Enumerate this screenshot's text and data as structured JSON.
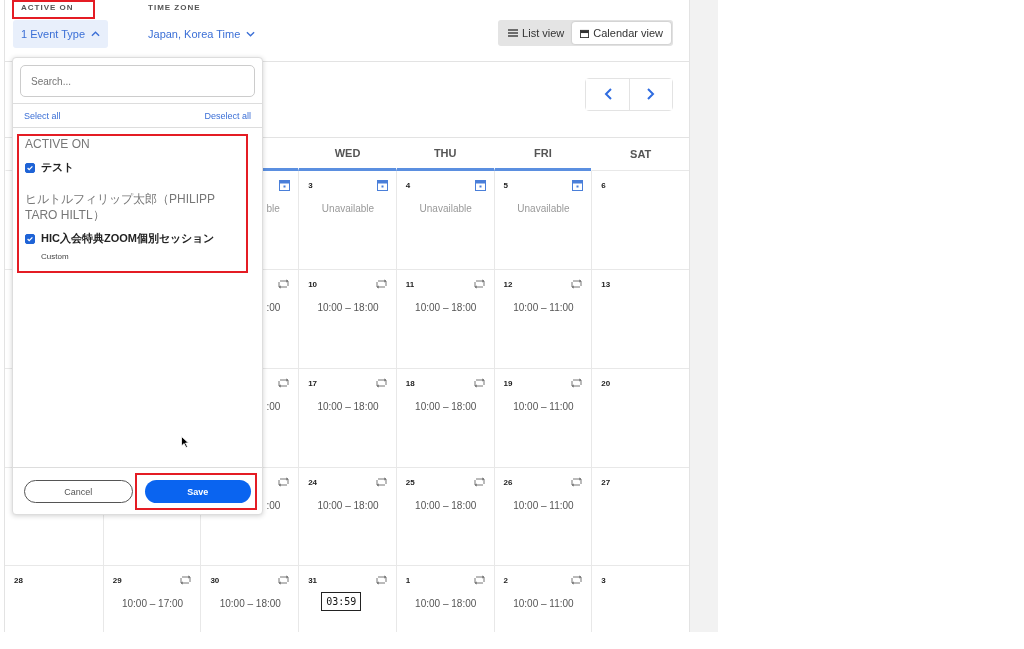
{
  "filters": [
    {
      "label": "ACTIVE ON",
      "value": "1 Event Type",
      "expanded": true
    },
    {
      "label": "TIME ZONE",
      "value": "Japan, Korea Time",
      "expanded": false
    }
  ],
  "view_toggle": [
    {
      "label": "List view",
      "selected": false
    },
    {
      "label": "Calendar view",
      "selected": true
    }
  ],
  "dropdown": {
    "search_placeholder": "Search...",
    "select_all": "Select all",
    "deselect_all": "Deselect all",
    "groups": [
      {
        "title": "ACTIVE ON",
        "items": [
          {
            "label": "テスト",
            "checked": true
          }
        ]
      },
      {
        "title": "ヒルトルフィリップ太郎（PHILIPP TARO HILTL）",
        "items": [
          {
            "label": "HIC入会特典ZOOM個別セッション",
            "sublabel": "Custom",
            "checked": true
          }
        ]
      }
    ],
    "cancel": "Cancel",
    "save": "Save"
  },
  "calendar": {
    "weekdays": [
      {
        "label": "WED",
        "highlighted": true
      },
      {
        "label": "THU",
        "highlighted": true
      },
      {
        "label": "FRI",
        "highlighted": true
      },
      {
        "label": "SAT",
        "highlighted": false
      }
    ],
    "weeks": [
      {
        "cells": [
          {
            "kind": "unavailable",
            "text": "ble"
          },
          {
            "day": "3",
            "kind": "unavailable",
            "text": "Unavailable"
          },
          {
            "day": "4",
            "kind": "unavailable",
            "text": "Unavailable"
          },
          {
            "day": "5",
            "kind": "unavailable",
            "text": "Unavailable"
          },
          {
            "day": "6"
          }
        ]
      },
      {
        "cells": [
          {
            "kind": "hours",
            "text": ":00"
          },
          {
            "day": "10",
            "kind": "hours",
            "text": "10:00 – 18:00"
          },
          {
            "day": "11",
            "kind": "hours",
            "text": "10:00 – 18:00"
          },
          {
            "day": "12",
            "kind": "hours",
            "text": "10:00 – 11:00"
          },
          {
            "day": "13"
          }
        ]
      },
      {
        "cells": [
          {
            "kind": "hours",
            "text": ":00"
          },
          {
            "day": "17",
            "kind": "hours",
            "text": "10:00 – 18:00"
          },
          {
            "day": "18",
            "kind": "hours",
            "text": "10:00 – 18:00"
          },
          {
            "day": "19",
            "kind": "hours",
            "text": "10:00 – 11:00"
          },
          {
            "day": "20"
          }
        ]
      },
      {
        "cells": [
          {
            "kind": "hours",
            "text": ":00"
          },
          {
            "day": "24",
            "kind": "hours",
            "text": "10:00 – 18:00"
          },
          {
            "day": "25",
            "kind": "hours",
            "text": "10:00 – 18:00"
          },
          {
            "day": "26",
            "kind": "hours",
            "text": "10:00 – 11:00"
          },
          {
            "day": "27"
          }
        ]
      },
      {
        "cells": [
          {
            "day": "28"
          },
          {
            "day": "29",
            "kind": "hours",
            "text": "10:00 – 17:00"
          },
          {
            "day": "30",
            "kind": "hours",
            "text": "10:00 – 18:00"
          },
          {
            "day": "31",
            "kind": "hours",
            "tooltip": "03:59"
          },
          {
            "day": "1",
            "kind": "hours",
            "text": "10:00 – 18:00"
          },
          {
            "day": "2",
            "kind": "hours",
            "text": "10:00 – 11:00"
          },
          {
            "day": "3"
          }
        ]
      }
    ]
  }
}
